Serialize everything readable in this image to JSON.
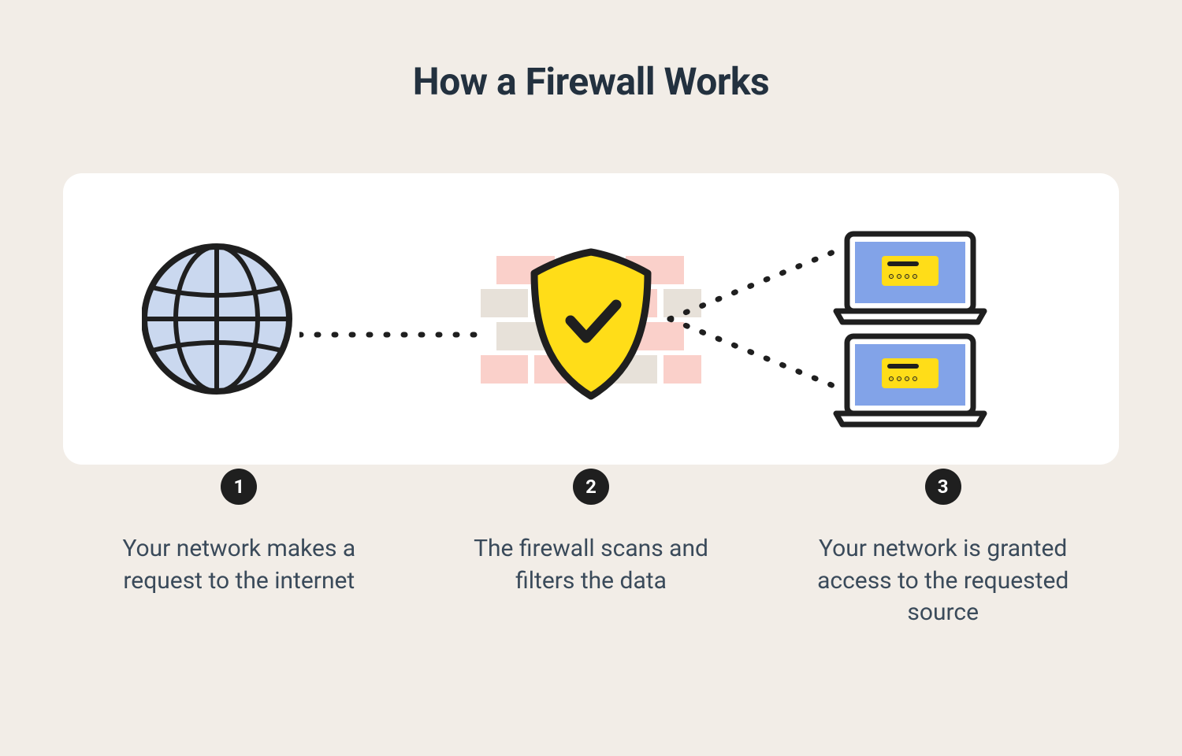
{
  "title": "How a Firewall Works",
  "steps": [
    {
      "num": "1",
      "desc": "Your network makes a request to the internet"
    },
    {
      "num": "2",
      "desc": "The firewall scans and filters the data"
    },
    {
      "num": "3",
      "desc": "Your network is granted access to the requested source"
    }
  ],
  "colors": {
    "globe_fill": "#cad8ef",
    "stroke": "#1f1f1f",
    "brick_a": "#fad0ca",
    "brick_b": "#e7e1d9",
    "shield_fill": "#ffdd18",
    "screen_fill": "#82a3e8",
    "card_fill": "#ffdd18"
  }
}
